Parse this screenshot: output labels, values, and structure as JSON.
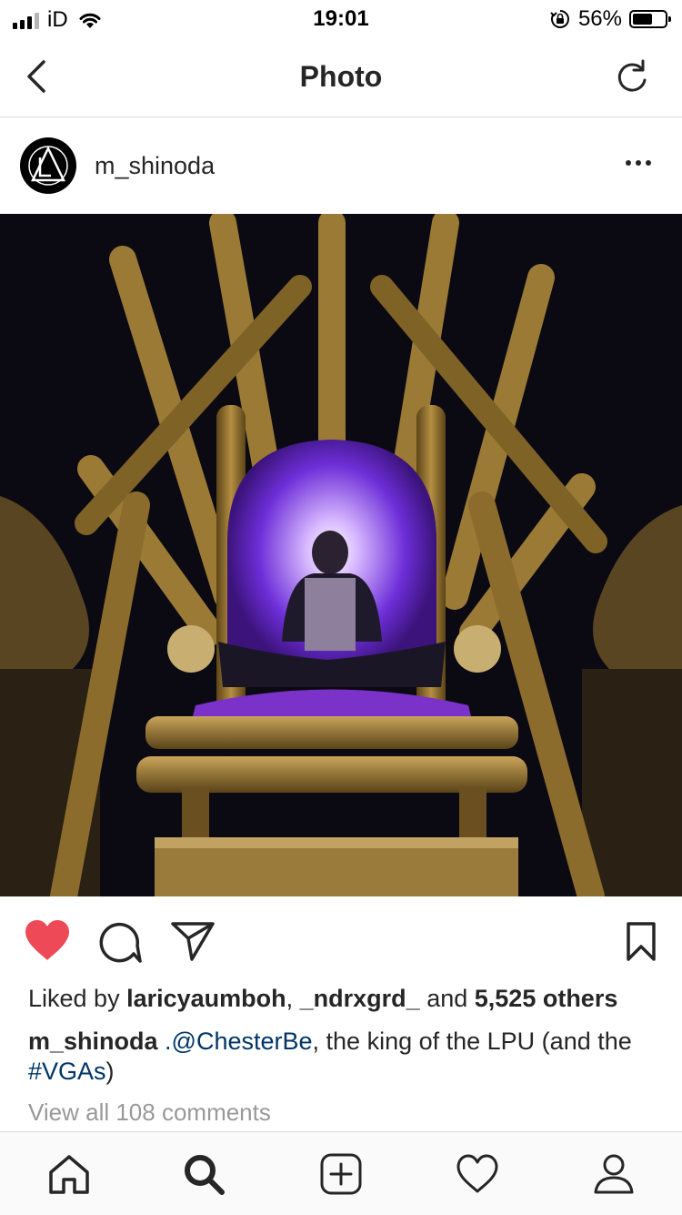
{
  "status_bar": {
    "carrier": "iD",
    "time": "19:01",
    "battery_percent": "56%",
    "battery_level": 0.56,
    "icons": [
      "signal-icon",
      "wifi-icon",
      "orientation-lock-icon",
      "battery-icon"
    ]
  },
  "nav": {
    "title": "Photo",
    "back_icon": "chevron-left-icon",
    "refresh_icon": "refresh-icon"
  },
  "post": {
    "username": "m_shinoda",
    "more_icon": "ellipsis-icon",
    "photo_alt": "image-photo",
    "liked": true,
    "likes": {
      "prefix": "Liked by ",
      "user1": "laricyaumboh",
      "sep": ", ",
      "user2": "_ndrxgrd_",
      "and": " and ",
      "others": "5,525 others"
    },
    "caption": {
      "user": "m_shinoda",
      "mention": ".@ChesterBe",
      "text1": ", the king of the LPU (and the ",
      "hashtag": "#VGAs",
      "text2": ")"
    },
    "view_comments": "View all 108 comments"
  },
  "tab_bar": {
    "items": [
      "home-icon",
      "search-icon",
      "new-post-icon",
      "activity-icon",
      "profile-icon"
    ]
  },
  "colors": {
    "like_red": "#ed4956",
    "link_blue": "#003569",
    "muted": "#999999",
    "divider": "#dbdbdb",
    "text": "#262626"
  }
}
